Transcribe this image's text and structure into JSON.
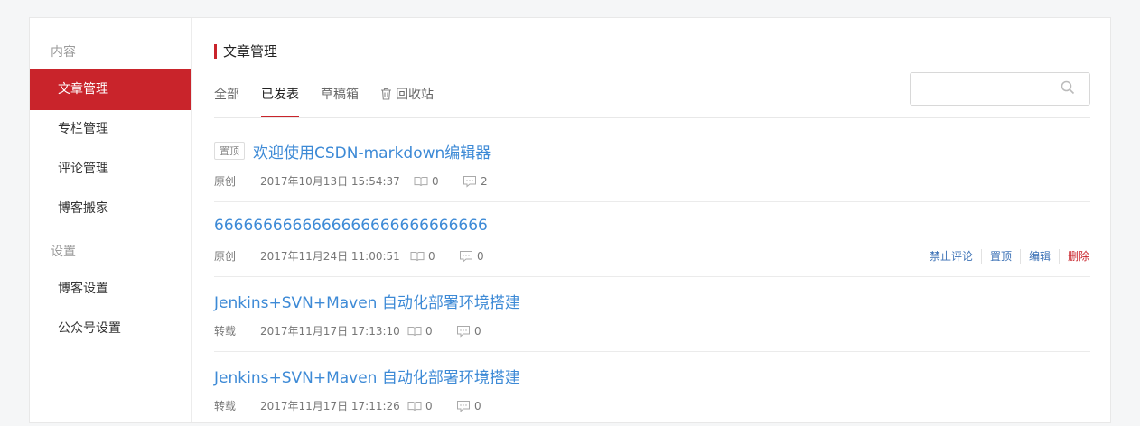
{
  "sidebar": {
    "sections": [
      {
        "title": "内容",
        "items": [
          {
            "label": "文章管理",
            "active": true
          },
          {
            "label": "专栏管理"
          },
          {
            "label": "评论管理"
          },
          {
            "label": "博客搬家"
          }
        ]
      },
      {
        "title": "设置",
        "items": [
          {
            "label": "博客设置"
          },
          {
            "label": "公众号设置"
          }
        ]
      }
    ]
  },
  "main": {
    "title": "文章管理",
    "tabs": [
      {
        "label": "全部"
      },
      {
        "label": "已发表",
        "active": true
      },
      {
        "label": "草稿箱"
      },
      {
        "label": "回收站",
        "icon": "trash-icon"
      }
    ],
    "search": {
      "value": "",
      "placeholder": ""
    }
  },
  "articles": [
    {
      "pinned": true,
      "pin_label": "置顶",
      "title": "欢迎使用CSDN-markdown编辑器",
      "type": "原创",
      "date": "2017年10月13日 15:54:37",
      "reads": "0",
      "comments": "2"
    },
    {
      "pinned": false,
      "title": "6666666666666666666666666666",
      "type": "原创",
      "date": "2017年11月24日 11:00:51",
      "reads": "0",
      "comments": "0",
      "actions": [
        "禁止评论",
        "置顶",
        "编辑",
        "删除"
      ]
    },
    {
      "pinned": false,
      "title": "Jenkins+SVN+Maven 自动化部署环境搭建",
      "type": "转载",
      "date": "2017年11月17日 17:13:10",
      "reads": "0",
      "comments": "0"
    },
    {
      "pinned": false,
      "title": "Jenkins+SVN+Maven 自动化部署环境搭建",
      "type": "转载",
      "date": "2017年11月17日 17:11:26",
      "reads": "0",
      "comments": "0"
    }
  ],
  "colors": {
    "accent": "#c9242b",
    "link": "#3d8ad6"
  }
}
